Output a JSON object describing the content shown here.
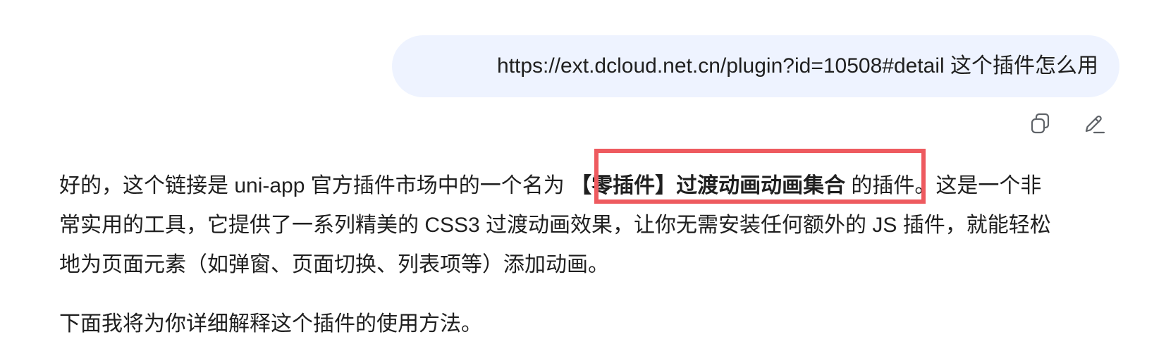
{
  "user_message": {
    "text": "https://ext.dcloud.net.cn/plugin?id=10508#detail 这个插件怎么用"
  },
  "message_actions": {
    "copy_icon": "copy-icon",
    "edit_icon": "pencil-icon"
  },
  "answer": {
    "paragraph1": {
      "line1_prefix": "好的，这个链接是 uni-app 官方插件市场中的一个名为 ",
      "highlight": "【零插件】过渡动画动画集合",
      "line1_suffix": " 的插件。这是一个非",
      "line2": "常实用的工具，它提供了一系列精美的 CSS3 过渡动画效果，让你无需安装任何额外的 JS 插件，就能轻松",
      "line3": "地为页面元素（如弹窗、页面切换、列表项等）添加动画。"
    },
    "paragraph2": "下面我将为你详细解释这个插件的使用方法。"
  },
  "colors": {
    "bubble_bg": "#eef3ff",
    "highlight_border": "#ee5a5f",
    "text": "#1f1f1f",
    "icon": "#5f6368"
  }
}
